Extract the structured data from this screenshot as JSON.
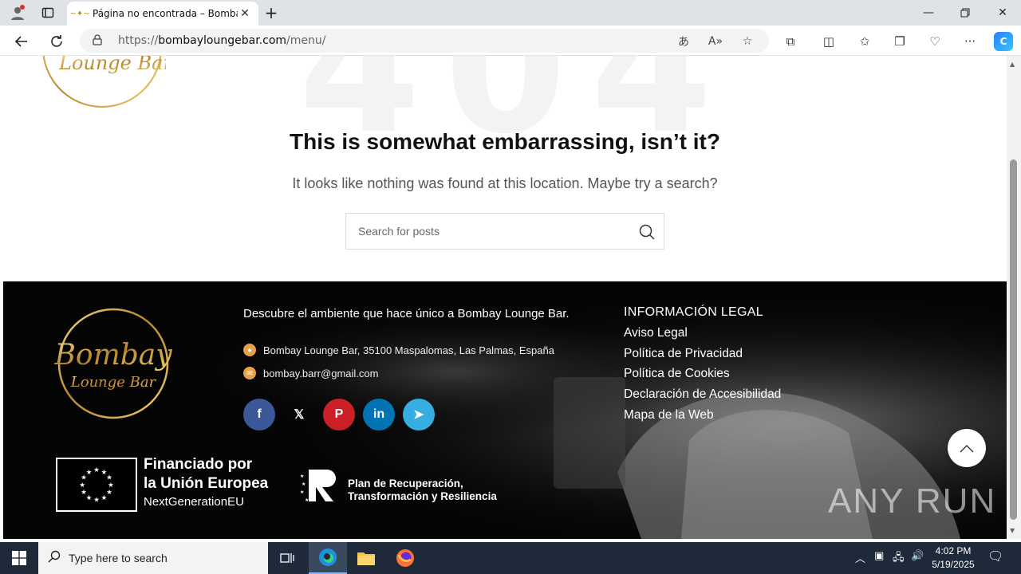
{
  "browser": {
    "tab_title": "Página no encontrada – Bombay",
    "url_host": "bombayloungebar.com",
    "url_scheme": "https://",
    "url_path": "/menu/"
  },
  "page": {
    "bg_number": "404",
    "title": "This is somewhat embarrassing, isn’t it?",
    "subtitle": "It looks like nothing was found at this location. Maybe try a search?",
    "search_placeholder": "Search for posts"
  },
  "footer": {
    "tagline": "Descubre el ambiente que hace único a Bombay Lounge Bar.",
    "address": "Bombay Lounge Bar, 35100 Maspalomas, Las Palmas, España",
    "email": "bombay.barr@gmail.com",
    "socials": [
      {
        "name": "facebook",
        "glyph": "f",
        "color": "#3b5998"
      },
      {
        "name": "x",
        "glyph": "𝕏",
        "color": "transparent"
      },
      {
        "name": "pinterest",
        "glyph": "P",
        "color": "#cb2027"
      },
      {
        "name": "linkedin",
        "glyph": "in",
        "color": "#0274b3"
      },
      {
        "name": "telegram",
        "glyph": "➤",
        "color": "#37aee2"
      }
    ],
    "legal_heading": "INFORMACIÓN LEGAL",
    "legal_links": [
      "Aviso Legal",
      "Política de Privacidad",
      "Política de Cookies",
      "Declaración de Accesibilidad",
      "Mapa de la Web"
    ],
    "eu_line1": "Financiado por",
    "eu_line2": "la Unión Europea",
    "eu_line3": "NextGenerationEU",
    "prtr_line1": "Plan de Recuperación,",
    "prtr_line2": "Transformación y Resiliencia",
    "logo_word1": "Bombay",
    "logo_word2": "Lounge Bar"
  },
  "watermark": "ANY RUN",
  "taskbar": {
    "search_placeholder": "Type here to search",
    "time": "4:02 PM",
    "date": "5/19/2025"
  },
  "colors": {
    "gold": "#d4a93a",
    "footer_bg": "#050505",
    "taskbar_bg": "#1e2a3a"
  }
}
